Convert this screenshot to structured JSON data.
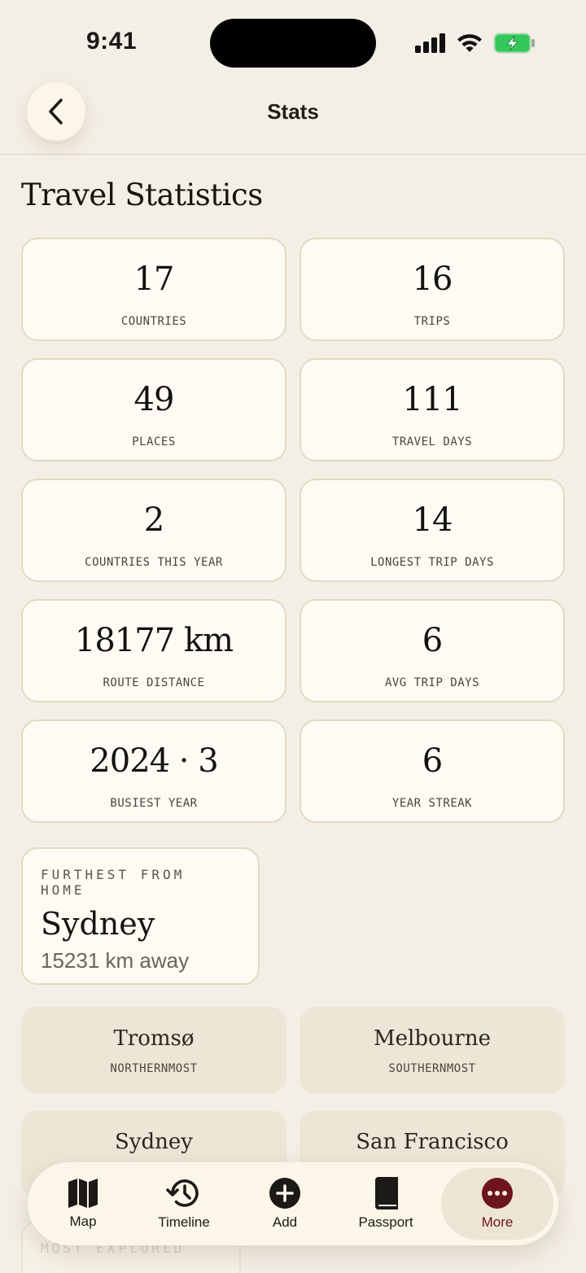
{
  "status_bar": {
    "time": "9:41"
  },
  "nav": {
    "title": "Stats"
  },
  "page": {
    "heading": "Travel Statistics"
  },
  "stats": [
    {
      "value": "17",
      "label": "COUNTRIES"
    },
    {
      "value": "16",
      "label": "TRIPS"
    },
    {
      "value": "49",
      "label": "PLACES"
    },
    {
      "value": "111",
      "label": "TRAVEL DAYS"
    },
    {
      "value": "2",
      "label": "COUNTRIES THIS YEAR"
    },
    {
      "value": "14",
      "label": "LONGEST TRIP DAYS"
    },
    {
      "value": "18177 km",
      "label": "ROUTE DISTANCE"
    },
    {
      "value": "6",
      "label": "AVG TRIP DAYS"
    },
    {
      "value": "2024 · 3",
      "label": "BUSIEST YEAR"
    },
    {
      "value": "6",
      "label": "YEAR STREAK"
    }
  ],
  "furthest": {
    "kicker": "FURTHEST FROM HOME",
    "city": "Sydney",
    "distance": "15231 km away"
  },
  "extremes": [
    {
      "city": "Tromsø",
      "label": "NORTHERNMOST"
    },
    {
      "city": "Melbourne",
      "label": "SOUTHERNMOST"
    },
    {
      "city": "Sydney",
      "label": ""
    },
    {
      "city": "San Francisco",
      "label": ""
    }
  ],
  "most_explored": {
    "kicker": "MOST EXPLORED"
  },
  "tabs": [
    {
      "label": "Map",
      "icon": "map-icon"
    },
    {
      "label": "Timeline",
      "icon": "history-icon"
    },
    {
      "label": "Add",
      "icon": "add-icon"
    },
    {
      "label": "Passport",
      "icon": "book-icon"
    },
    {
      "label": "More",
      "icon": "more-icon"
    }
  ],
  "colors": {
    "background": "#f4efe6",
    "accent": "#6e1420",
    "card": "#fdfbf3",
    "battery": "#34c759"
  }
}
